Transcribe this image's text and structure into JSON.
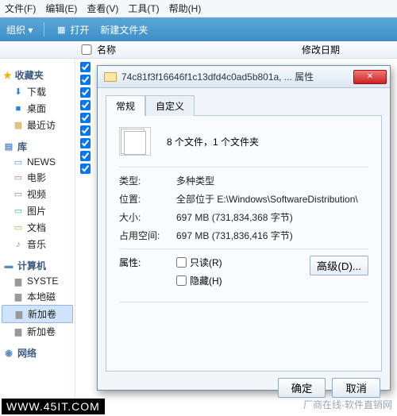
{
  "menu": {
    "file": "文件(F)",
    "edit": "编辑(E)",
    "view": "查看(V)",
    "tools": "工具(T)",
    "help": "帮助(H)"
  },
  "toolbar": {
    "organize": "组织 ▾",
    "open": "打开",
    "newfolder": "新建文件夹"
  },
  "columns": {
    "name": "名称",
    "date": "修改日期"
  },
  "sidebar": {
    "fav_head": "收藏夹",
    "fav": [
      "下载",
      "桌面",
      "最近访"
    ],
    "lib_head": "库",
    "lib": [
      "NEWS",
      "电影",
      "视频",
      "图片",
      "文档",
      "音乐"
    ],
    "comp_head": "计算机",
    "comp": [
      "SYSTE",
      "本地磁",
      "新加卷",
      "新加卷"
    ],
    "net_head": "网络"
  },
  "dialog": {
    "title": "74c81f3f16646f1c13dfd4c0ad5b801a, ... 属性",
    "tabs": {
      "general": "常规",
      "custom": "自定义"
    },
    "summary": "8 个文件，1 个文件夹",
    "type_k": "类型:",
    "type_v": "多种类型",
    "loc_k": "位置:",
    "loc_v": "全部位于 E:\\Windows\\SoftwareDistribution\\",
    "size_k": "大小:",
    "size_v": "697 MB (731,834,368 字节)",
    "disk_k": "占用空间:",
    "disk_v": "697 MB (731,836,416 字节)",
    "attr_k": "属性:",
    "readonly": "只读(R)",
    "hidden": "隐藏(H)",
    "advanced": "高级(D)...",
    "ok": "确定",
    "cancel": "取消"
  },
  "watermark": "WWW.45IT.COM",
  "footer": "厂商在线-软件直销网"
}
